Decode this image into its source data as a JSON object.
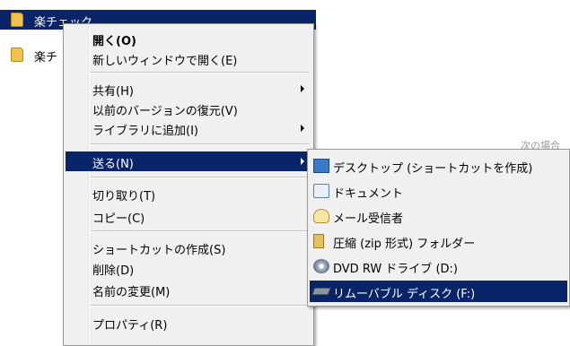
{
  "explorer": {
    "files": [
      {
        "label": "楽チェック",
        "selected": true
      },
      {
        "label": "楽チ"
      }
    ],
    "bg_text": "次の場合"
  },
  "context_menu": {
    "items": [
      {
        "id": "open",
        "label": "開く(O)",
        "bold": true
      },
      {
        "id": "open-new-window",
        "label": "新しいウィンドウで開く(E)"
      },
      {
        "id": "share",
        "label": "共有(H)",
        "submenu": true
      },
      {
        "id": "restore-previous",
        "label": "以前のバージョンの復元(V)"
      },
      {
        "id": "add-library",
        "label": "ライブラリに追加(I)",
        "submenu": true
      },
      {
        "id": "send-to",
        "label": "送る(N)",
        "submenu": true,
        "highlighted": true
      },
      {
        "id": "cut",
        "label": "切り取り(T)"
      },
      {
        "id": "copy",
        "label": "コピー(C)"
      },
      {
        "id": "create-shortcut",
        "label": "ショートカットの作成(S)"
      },
      {
        "id": "delete",
        "label": "削除(D)"
      },
      {
        "id": "rename",
        "label": "名前の変更(M)"
      },
      {
        "id": "properties",
        "label": "プロパティ(R)"
      }
    ]
  },
  "send_to_menu": {
    "items": [
      {
        "id": "desktop",
        "label": "デスクトップ (ショートカットを作成)",
        "icon": "desktop-icon"
      },
      {
        "id": "documents",
        "label": "ドキュメント",
        "icon": "documents-icon"
      },
      {
        "id": "mail",
        "label": "メール受信者",
        "icon": "mail-icon"
      },
      {
        "id": "zip",
        "label": "圧縮 (zip 形式) フォルダー",
        "icon": "zip-folder-icon"
      },
      {
        "id": "dvd",
        "label": "DVD RW ドライブ (D:)",
        "icon": "dvd-drive-icon"
      },
      {
        "id": "removable",
        "label": "リムーバブル ディスク (F:)",
        "icon": "removable-disk-icon",
        "highlighted": true
      }
    ]
  }
}
